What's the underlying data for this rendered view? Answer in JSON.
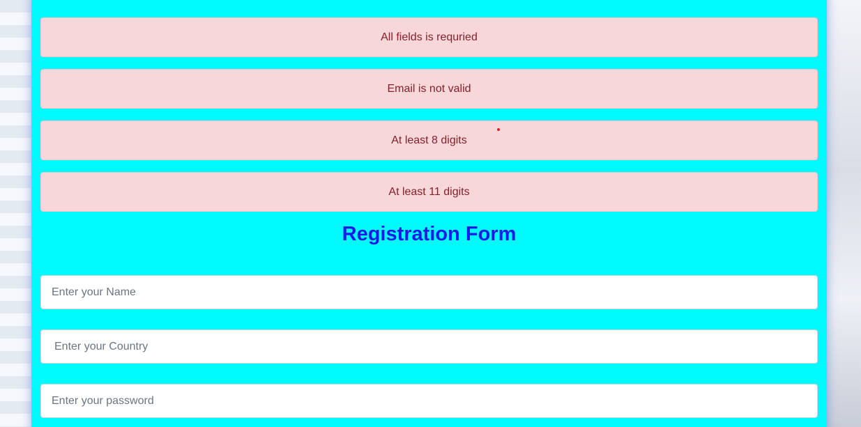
{
  "alerts": [
    {
      "text": "All fields is requried"
    },
    {
      "text": "Email is not valid"
    },
    {
      "text": "At least 8 digits"
    },
    {
      "text": "At least 11 digits"
    }
  ],
  "form": {
    "title": "Registration Form",
    "name_placeholder": "Enter your Name",
    "name_value": "",
    "country_placeholder": "Enter your Country",
    "country_value": "",
    "password_placeholder": "Enter your password",
    "password_value": ""
  },
  "colors": {
    "card_background": "#00fbff",
    "alert_background": "#f8d7da",
    "alert_text": "#842029",
    "title": "#1a1ae6"
  }
}
